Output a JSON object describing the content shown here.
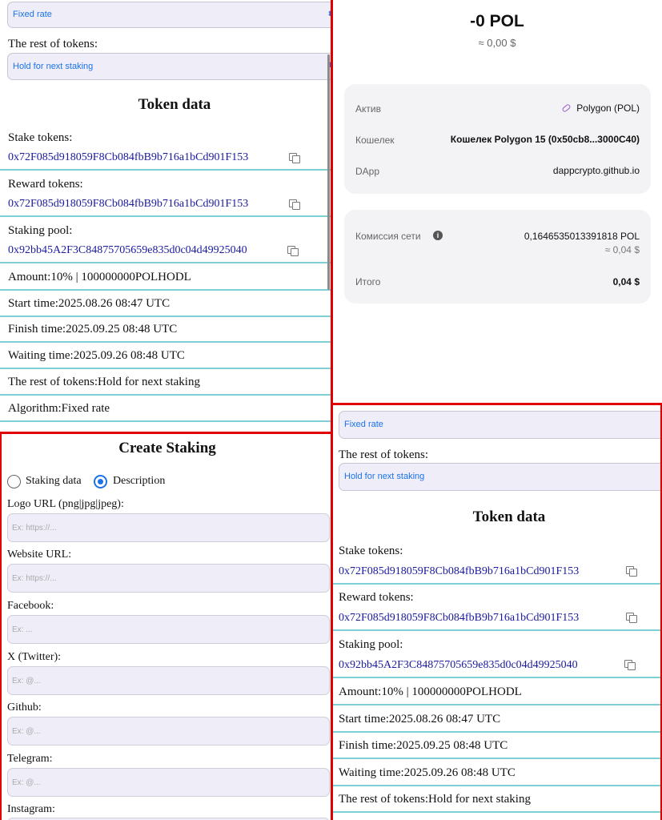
{
  "staking_panel": {
    "algorithm_select": "Fixed rate",
    "rest_label": "The rest of tokens:",
    "rest_select": "Hold for next staking",
    "token_data_title": "Token data",
    "stake_tokens_label": "Stake tokens:",
    "stake_tokens_address": "0x72F085d918059F8Cb084fbB9b716a1bCd901F153",
    "reward_tokens_label": "Reward tokens:",
    "reward_tokens_address": "0x72F085d918059F8Cb084fbB9b716a1bCd901F153",
    "staking_pool_label": "Staking pool:",
    "staking_pool_address": "0x92bb45A2F3C84875705659e835d0c04d49925040",
    "amount": "Amount:10% | 100000000POLHODL",
    "start_time": "Start time:2025.08.26 08:47 UTC",
    "finish_time": "Finish time:2025.09.25 08:48 UTC",
    "waiting_time": "Waiting time:2025.09.26 08:48 UTC",
    "rest_summary": "The rest of tokens:Hold for next staking",
    "algorithm_summary": "Algorithm:Fixed rate"
  },
  "wallet": {
    "amount": "-0 POL",
    "amount_usd": "≈ 0,00 $",
    "asset_label": "Актив",
    "asset_value": "Polygon (POL)",
    "wallet_label": "Кошелек",
    "wallet_value": "Кошелек Polygon 15 (0x50cb8...3000C40)",
    "dapp_label": "DApp",
    "dapp_value": "dappcrypto.github.io",
    "fee_label": "Комиссия сети",
    "fee_value": "0,1646535013391818 POL",
    "fee_usd": "≈ 0,04 $",
    "total_label": "Итого",
    "total_value": "0,04 $"
  },
  "create_form": {
    "title": "Create Staking",
    "tab_staking_data": "Staking data",
    "tab_description": "Description",
    "fields": [
      {
        "label": "Logo URL (png|jpg|jpeg):",
        "placeholder": "Ex: https://..."
      },
      {
        "label": "Website URL:",
        "placeholder": "Ex: https://..."
      },
      {
        "label": "Facebook:",
        "placeholder": "Ex: ..."
      },
      {
        "label": "X (Twitter):",
        "placeholder": "Ex: @..."
      },
      {
        "label": "Github:",
        "placeholder": "Ex: @..."
      },
      {
        "label": "Telegram:",
        "placeholder": "Ex: @..."
      },
      {
        "label": "Instagram:",
        "placeholder": ""
      }
    ]
  },
  "colors": {
    "accent": "#1a73e8",
    "divider": "#7fcfd6",
    "frame": "#e00000"
  }
}
